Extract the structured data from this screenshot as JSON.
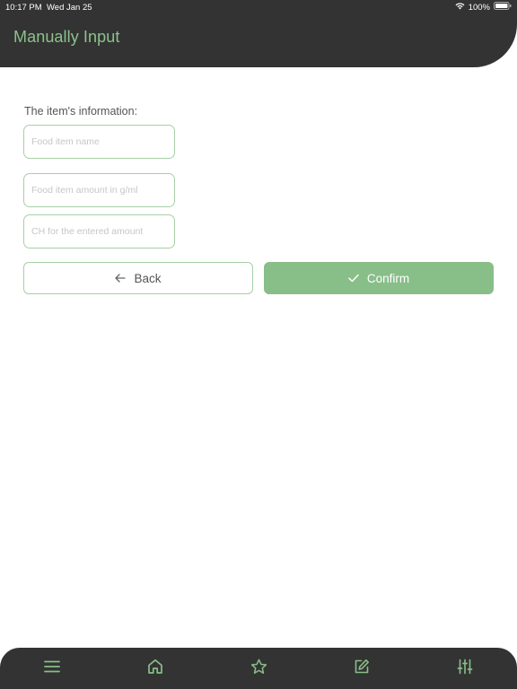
{
  "status_bar": {
    "time": "10:17 PM",
    "date": "Wed Jan 25",
    "battery": "100%"
  },
  "header": {
    "title": "Manually Input"
  },
  "form": {
    "label": "The item's information:",
    "fields": [
      {
        "placeholder": "Food item name",
        "value": ""
      },
      {
        "placeholder": "Food item amount in g/ml",
        "value": ""
      },
      {
        "placeholder": "CH for the entered amount",
        "value": ""
      }
    ]
  },
  "buttons": {
    "back_label": "Back",
    "back_icon": "arrow-left-icon",
    "confirm_label": "Confirm",
    "confirm_icon": "check-icon"
  },
  "bottom_nav": {
    "items": [
      {
        "icon": "menu-icon"
      },
      {
        "icon": "home-icon"
      },
      {
        "icon": "star-icon"
      },
      {
        "icon": "edit-icon"
      },
      {
        "icon": "sliders-icon"
      }
    ]
  },
  "colors": {
    "accent": "#88be88",
    "accent_text": "#8bc28b",
    "dark": "#333333",
    "border": "#a8cfa8"
  }
}
